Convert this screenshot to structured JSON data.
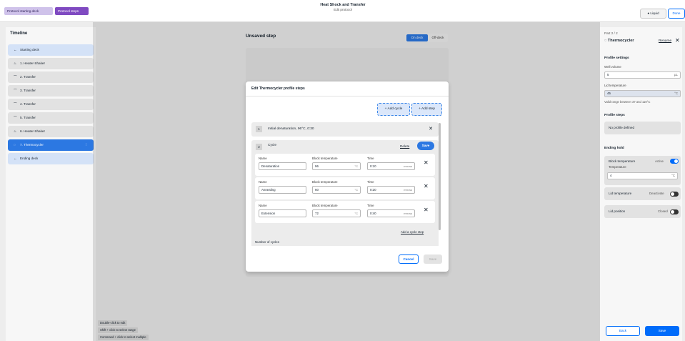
{
  "header": {
    "tab_start": "Protocol starting deck",
    "tab_steps": "Protocol steps",
    "title": "Heat Shock and Transfer",
    "subtitle": "Edit protocol",
    "liquid_label": "Liquid",
    "liquid_icon": "droplet-icon",
    "done_label": "Done"
  },
  "timeline": {
    "title": "Timeline",
    "items": [
      {
        "label": "Starting deck",
        "icon": "arrow-left-icon",
        "glyph": "←"
      },
      {
        "label": "1. Heater-Shaker",
        "icon": "heater-shaker-icon",
        "glyph": "♨"
      },
      {
        "label": "2. Transfer",
        "icon": "transfer-icon",
        "glyph": "⌒"
      },
      {
        "label": "3. Transfer",
        "icon": "transfer-icon",
        "glyph": "⌒"
      },
      {
        "label": "4. Transfer",
        "icon": "transfer-icon",
        "glyph": "⌒"
      },
      {
        "label": "5. Transfer",
        "icon": "transfer-icon",
        "glyph": "⌒"
      },
      {
        "label": "6. Heater-Shaker",
        "icon": "heater-shaker-icon",
        "glyph": "♨"
      },
      {
        "label": "7. Thermocycler",
        "icon": "thermocycler-icon",
        "glyph": "◌"
      },
      {
        "label": "Ending deck",
        "icon": "arrow-left-icon",
        "glyph": "←"
      }
    ],
    "active_menu": "⋮"
  },
  "hints": [
    "Double-click to edit",
    "Shift + click to select range",
    "Command + click to select multiple"
  ],
  "deck": {
    "step_title": "Unsaved step",
    "on_deck": "On deck",
    "off_deck": "Off-deck"
  },
  "modal": {
    "title": "Edit Thermocycler profile steps",
    "add_cycle": "+ Add cycle",
    "add_step": "+ Add step",
    "step1": {
      "num": "1",
      "label": "Initial denaturation, 96°C, 0:30"
    },
    "cycle": {
      "num": "2",
      "label": "Cycle",
      "delete": "Delete",
      "save": "Save",
      "col_name": "Name",
      "col_temp": "Block temperature",
      "col_time": "Time",
      "temp_unit": "°C",
      "time_unit": "mm:ss",
      "steps": [
        {
          "name": "Denaturation",
          "temp": "96",
          "time": "0:10"
        },
        {
          "name": "Annealing",
          "temp": "60",
          "time": "0:20"
        },
        {
          "name": "Extension",
          "temp": "72",
          "time": "0:40"
        }
      ],
      "add_cycle_step": "Add a cycle step",
      "number_of_cycles": "Number of cycles"
    },
    "cancel": "Cancel",
    "save": "Save"
  },
  "right_panel": {
    "part": "Part 2 / 2",
    "name": "Thermocycler",
    "name_icon": "thermocycler-icon",
    "rename": "Rename",
    "profile_settings": "Profile settings",
    "well_volume_label": "Well volume",
    "well_volume_value": "5",
    "well_volume_unit": "µL",
    "lid_temp_label": "Lid temperature",
    "lid_temp_value": "45",
    "lid_temp_unit": "°C",
    "lid_temp_hint": "Valid range between 37 and 110°C",
    "profile_steps": "Profile steps",
    "no_profile": "No profile defined",
    "ending_hold": "Ending hold",
    "block_temp_label": "Block temperature",
    "block_temp_status": "Active",
    "block_temp_sub": "Temperature",
    "block_temp_value": "4",
    "block_temp_unit": "°C",
    "lid_temperature_label": "Lid temperature",
    "lid_temperature_status": "Deactivate",
    "lid_position_label": "Lid position",
    "lid_position_status": "Closed",
    "back": "Back",
    "save": "Save"
  },
  "colors": {
    "accent": "#006cfa",
    "active_item": "#2c78e2",
    "tab_steps": "#7f4ac1",
    "tab_start": "#cfc2ea"
  }
}
